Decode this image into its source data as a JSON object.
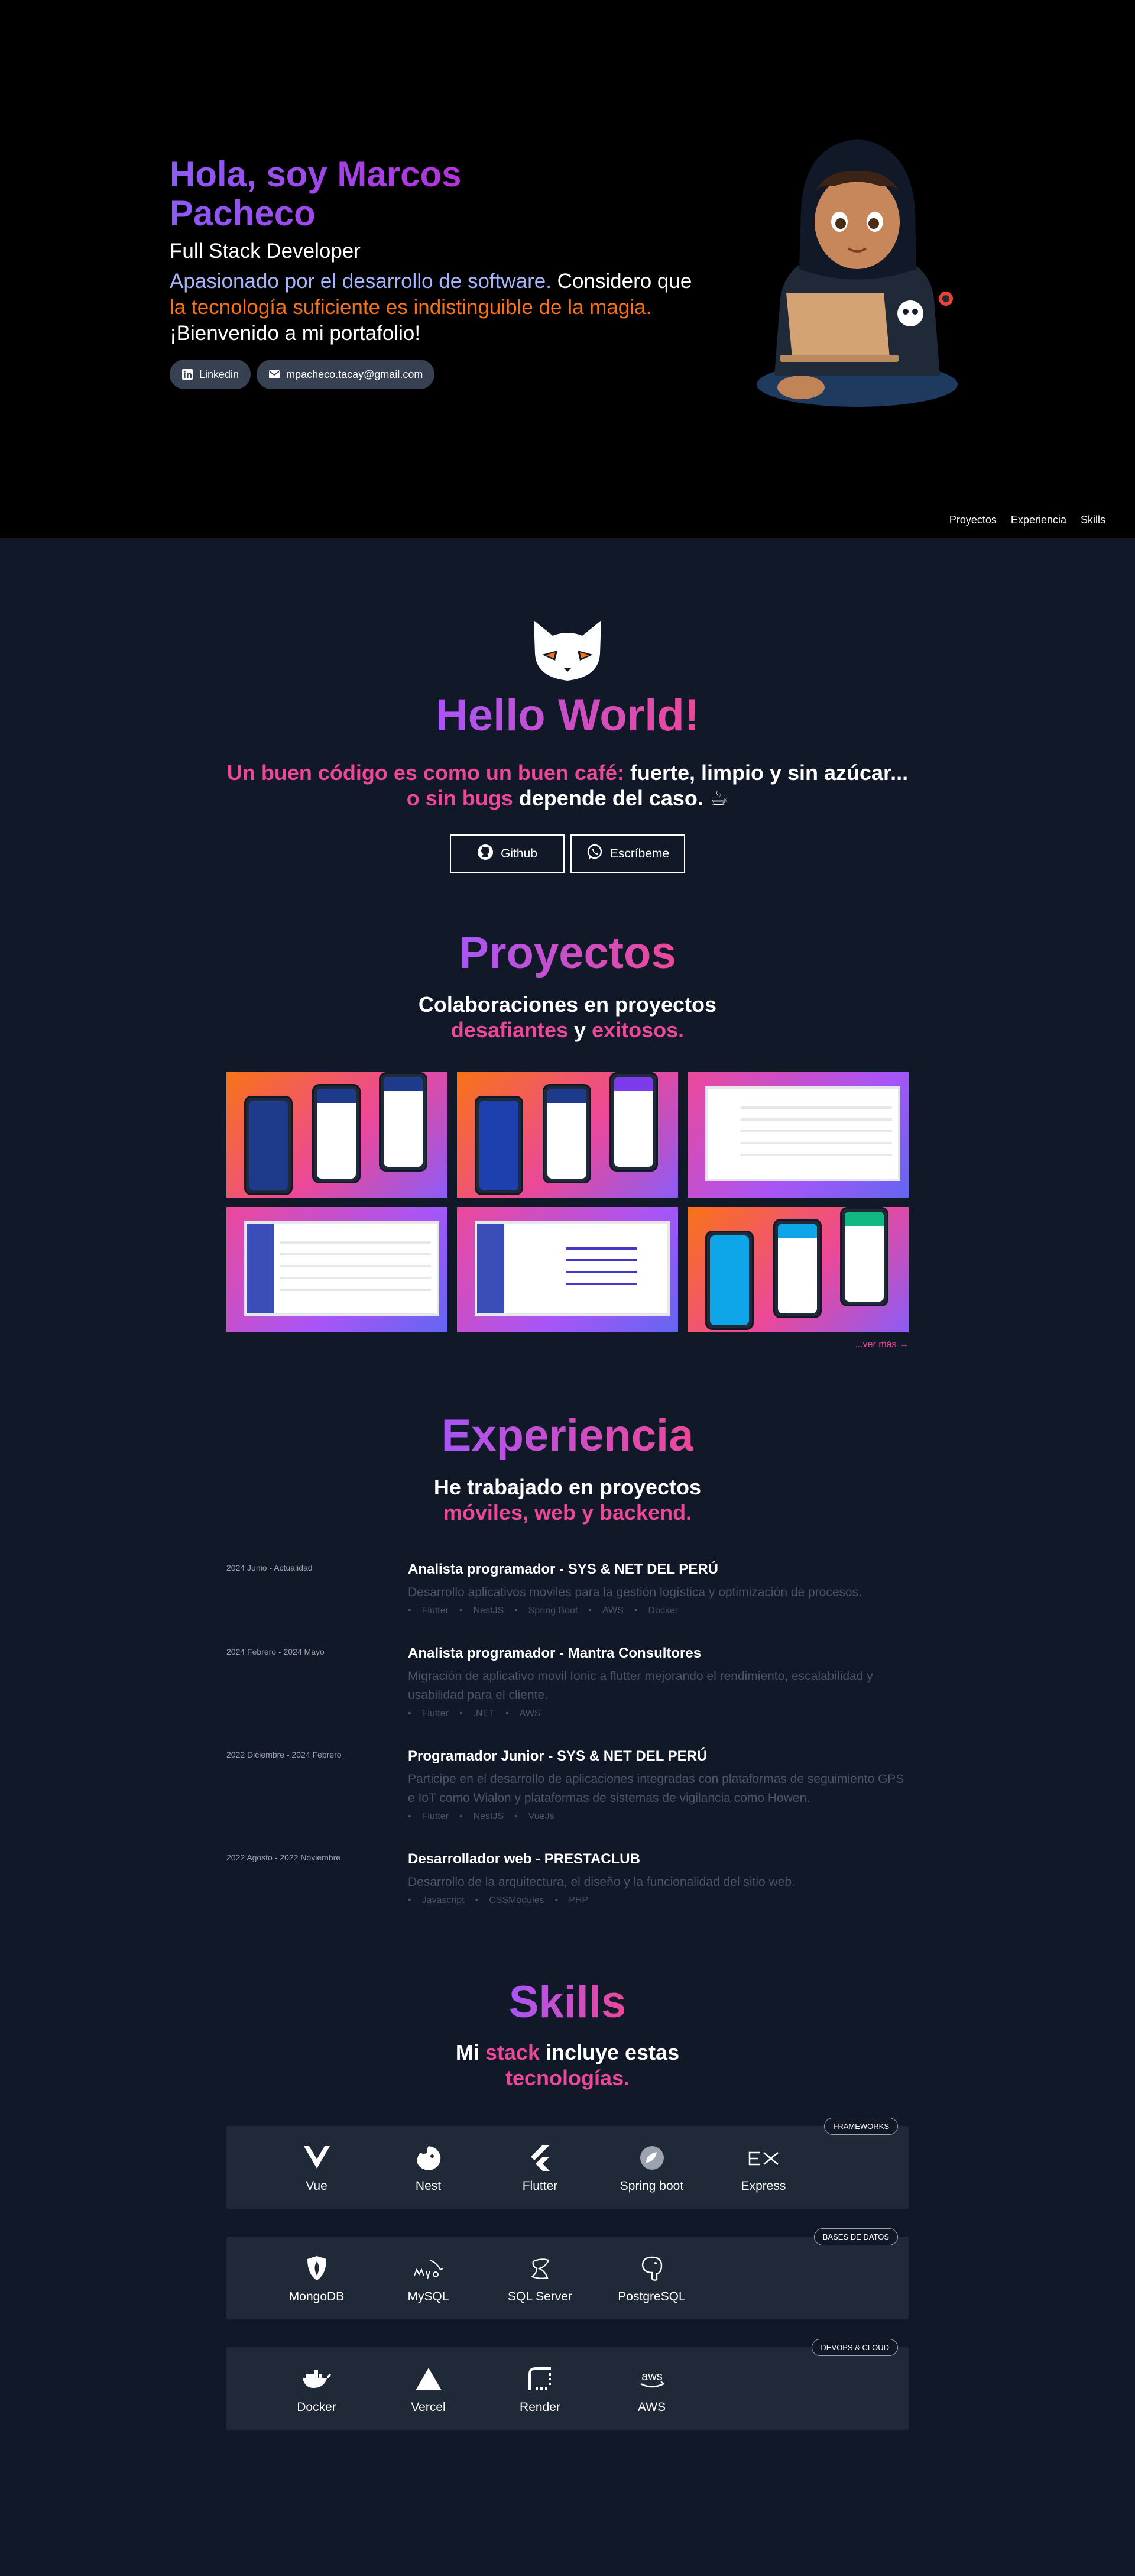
{
  "hero": {
    "title": "Hola, soy Marcos Pacheco",
    "role": "Full Stack Developer",
    "desc_part1": "Apasionado por el desarrollo de software.",
    "desc_part2": " Considero que ",
    "desc_part3": "la tecnología suficiente es indistinguible de la magia.",
    "desc_part4": " ¡Bienvenido a mi portafolio!",
    "linkedin_label": "Linkedin",
    "email_label": "mpacheco.tacay@gmail.com"
  },
  "nav": {
    "items": [
      "Proyectos",
      "Experiencia",
      "Skills"
    ]
  },
  "intro": {
    "heading": "Hello World!",
    "quote_pink1": "Un buen código es como un buen café:",
    "quote_white1": " fuerte, limpio y sin azúcar...",
    "quote_pink2": "o sin bugs",
    "quote_white2": " depende del caso. ☕",
    "github_label": "Github",
    "write_label": "Escríbeme"
  },
  "projects": {
    "heading": "Proyectos",
    "sub_line1": "Colaboraciones en proyectos",
    "sub_pink1": "desafiantes",
    "sub_and": " y ",
    "sub_pink2": "exitosos.",
    "more_label": "...ver más →"
  },
  "experience": {
    "heading": "Experiencia",
    "sub_line1": "He trabajado en proyectos",
    "sub_pink": "móviles, web y backend.",
    "jobs": [
      {
        "date": "2024 Junio - Actualidad",
        "title": "Analista programador - SYS & NET DEL PERÚ",
        "desc": "Desarrollo aplicativos moviles para la gestión logística y optimización de procesos.",
        "tags": [
          "Flutter",
          "NestJS",
          "Spring Boot",
          "AWS",
          "Docker"
        ]
      },
      {
        "date": "2024 Febrero - 2024 Mayo",
        "title": "Analista programador - Mantra Consultores",
        "desc": "Migración de aplicativo movil Ionic a flutter mejorando el rendimiento, escalabilidad y usabilidad para el cliente.",
        "tags": [
          "Flutter",
          ".NET",
          "AWS"
        ]
      },
      {
        "date": "2022 Diciembre - 2024 Febrero",
        "title": "Programador Junior - SYS & NET DEL PERÚ",
        "desc": "Participe en el desarrollo de aplicaciones integradas con plataformas de seguimiento GPS e IoT como Wialon y plataformas de sistemas de vigilancia como Howen.",
        "tags": [
          "Flutter",
          "NestJS",
          "VueJs"
        ]
      },
      {
        "date": "2022 Agosto - 2022 Noviembre",
        "title": "Desarrollador web - PRESTACLUB",
        "desc": "Desarrollo de la arquitectura, el diseño y la funcionalidad del sitio web.",
        "tags": [
          "Javascript",
          "CSSModules",
          "PHP"
        ]
      }
    ]
  },
  "skills": {
    "heading": "Skills",
    "sub_mi": "Mi ",
    "sub_stack": "stack",
    "sub_rest": " incluye estas",
    "sub_pink": "tecnologías.",
    "groups": [
      {
        "badge": "FRAMEWORKS",
        "items": [
          "Vue",
          "Nest",
          "Flutter",
          "Spring boot",
          "Express"
        ]
      },
      {
        "badge": "BASES DE DATOS",
        "items": [
          "MongoDB",
          "MySQL",
          "SQL Server",
          "PostgreSQL"
        ]
      },
      {
        "badge": "DEVOPS & CLOUD",
        "items": [
          "Docker",
          "Vercel",
          "Render",
          "AWS"
        ]
      }
    ]
  },
  "colors": {
    "background": "#111827",
    "hero_bg": "#000000",
    "pink": "#ec4899",
    "violet": "#8b5cf6",
    "orange": "#f97316"
  }
}
